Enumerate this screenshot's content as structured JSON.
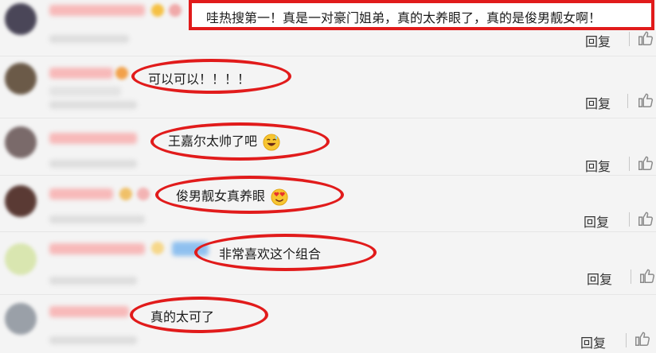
{
  "comments": [
    {
      "text": "哇热搜第一！真是一对豪门姐弟，真的太养眼了，真的是俊男靓女啊！",
      "reply_label": "回复"
    },
    {
      "text": "可以可以！！！！",
      "reply_label": "回复"
    },
    {
      "text": "王嘉尔太帅了吧",
      "emoji": "grinning-sweat-emoji",
      "reply_label": "回复"
    },
    {
      "text": "俊男靓女真养眼",
      "emoji": "heart-eyes-emoji",
      "reply_label": "回复"
    },
    {
      "text": "非常喜欢这个组合",
      "reply_label": "回复"
    },
    {
      "text": "真的太可了",
      "reply_label": "回复"
    }
  ],
  "icons": {
    "like": "thumbs-up-icon"
  },
  "colors": {
    "highlight": "#e11b1b",
    "background": "#f4f4f4"
  }
}
